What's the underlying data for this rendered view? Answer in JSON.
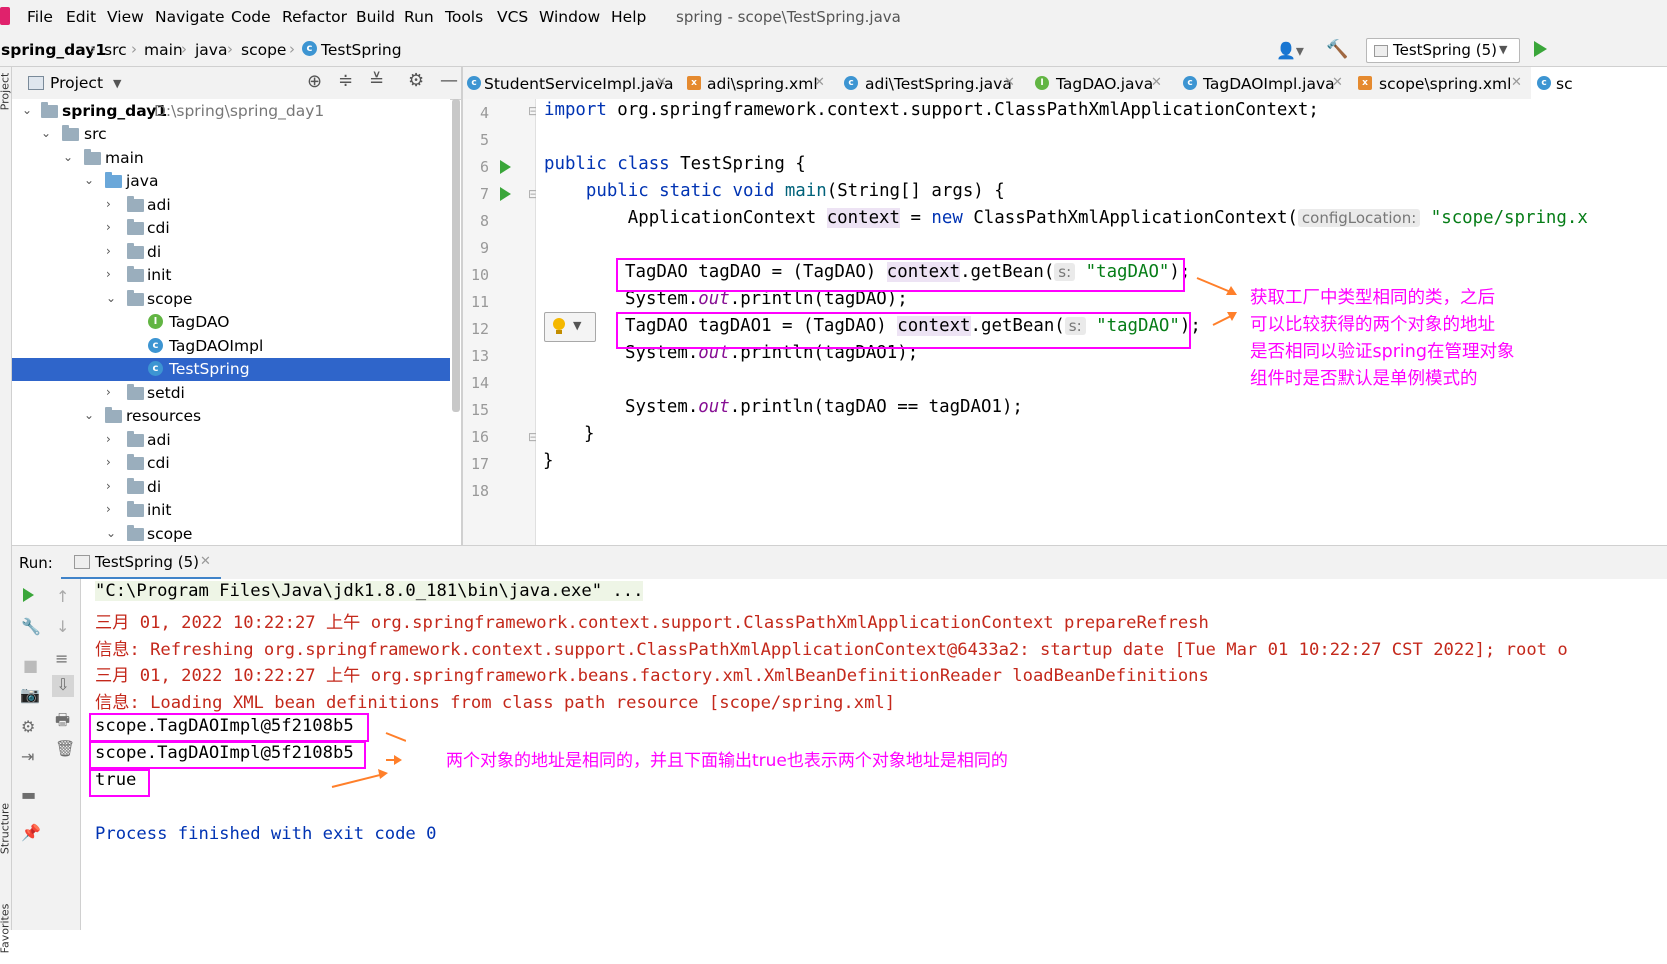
{
  "menu": {
    "items": [
      "File",
      "Edit",
      "View",
      "Navigate",
      "Code",
      "Refactor",
      "Build",
      "Run",
      "Tools",
      "VCS",
      "Window",
      "Help"
    ],
    "window_title": "spring - scope\\TestSpring.java"
  },
  "breadcrumb": {
    "project": "spring_day1",
    "parts": [
      "src",
      "main",
      "java",
      "scope",
      "TestSpring"
    ]
  },
  "run_config": {
    "label": "TestSpring (5)"
  },
  "project_panel": {
    "title": "Project",
    "root_label": "spring_day1",
    "root_path": "D:\\spring\\spring_day1",
    "rows": [
      {
        "label": "src"
      },
      {
        "label": "main"
      },
      {
        "label": "java"
      },
      {
        "label": "adi"
      },
      {
        "label": "cdi"
      },
      {
        "label": "di"
      },
      {
        "label": "init"
      },
      {
        "label": "scope"
      },
      {
        "label": "TagDAO"
      },
      {
        "label": "TagDAOImpl"
      },
      {
        "label": "TestSpring"
      },
      {
        "label": "setdi"
      },
      {
        "label": "resources"
      },
      {
        "label": "adi"
      },
      {
        "label": "cdi"
      },
      {
        "label": "di"
      },
      {
        "label": "init"
      },
      {
        "label": "scope"
      }
    ]
  },
  "tabs": [
    {
      "label": "StudentServiceImpl.java"
    },
    {
      "label": "adi\\spring.xml"
    },
    {
      "label": "adi\\TestSpring.java"
    },
    {
      "label": "TagDAO.java"
    },
    {
      "label": "TagDAOImpl.java"
    },
    {
      "label": "scope\\spring.xml"
    },
    {
      "label": "sc"
    }
  ],
  "editor": {
    "line_numbers": [
      "4",
      "5",
      "6",
      "7",
      "8",
      "9",
      "10",
      "11",
      "12",
      "13",
      "14",
      "15",
      "16",
      "17",
      "18"
    ],
    "line4": {
      "kw": "import",
      "rest": " org.springframework.context.support.ClassPathXmlApplicationContext;"
    },
    "line6": {
      "kw": "public class",
      "rest": " TestSpring {"
    },
    "line7": {
      "indent": "    ",
      "kw": "public static void",
      "name": " main",
      "rest": "(String[] args) {"
    },
    "line8": {
      "indent": "        ",
      "type": "ApplicationContext ",
      "var": "context",
      "eq": " = ",
      "kw": "new",
      "cls": " ClassPathXmlApplicationContext(",
      "hint": "configLocation:",
      "str": " \"scope/spring.x"
    },
    "line10": {
      "pre": "TagDAO tagDAO = (TagDAO) ",
      "var": "context",
      "call": ".getBean(",
      "hint": "s:",
      "str": " \"tagDAO\"",
      "end": ");"
    },
    "line11": {
      "pre": "System.",
      "fld": "out",
      "post": ".println(tagDAO);"
    },
    "line12": {
      "pre": "TagDAO tagDAO1 = (TagDAO) ",
      "var": "context",
      "call": ".getBean(",
      "hint": "s:",
      "str": " \"tagDAO\"",
      "end": ");"
    },
    "line13": {
      "pre": "System.",
      "fld": "out",
      "post": ".println(tagDAO1);"
    },
    "line15": {
      "pre": "System.",
      "fld": "out",
      "post": ".println(tagDAO == tagDAO1);"
    },
    "line16": "}",
    "line17": "}",
    "annotation": [
      "获取工厂中类型相同的类，之后",
      "可以比较获得的两个对象的地址",
      "是否相同以验证spring在管理对象",
      "组件时是否默认是单例模式的"
    ]
  },
  "run_panel": {
    "label": "Run:",
    "tab": "TestSpring (5)",
    "console": [
      "\"C:\\Program Files\\Java\\jdk1.8.0_181\\bin\\java.exe\" ...",
      "三月 01, 2022 10:22:27 上午 org.springframework.context.support.ClassPathXmlApplicationContext prepareRefresh",
      "信息: Refreshing org.springframework.context.support.ClassPathXmlApplicationContext@6433a2: startup date [Tue Mar 01 10:22:27 CST 2022]; root o",
      "三月 01, 2022 10:22:27 上午 org.springframework.beans.factory.xml.XmlBeanDefinitionReader loadBeanDefinitions",
      "信息: Loading XML bean definitions from class path resource [scope/spring.xml]",
      "scope.TagDAOImpl@5f2108b5",
      "scope.TagDAOImpl@5f2108b5",
      "true",
      "Process finished with exit code 0"
    ],
    "annotation": "两个对象的地址是相同的，并且下面输出true也表示两个对象地址是相同的"
  },
  "side_labels": {
    "project": "Project",
    "structure": "Structure",
    "favorites": "Favorites"
  },
  "colors": {
    "annotation": "#ff00ff",
    "selection": "#2f65ca",
    "keyword": "#0033b3",
    "string": "#067d17",
    "log_red": "#c4281b"
  }
}
